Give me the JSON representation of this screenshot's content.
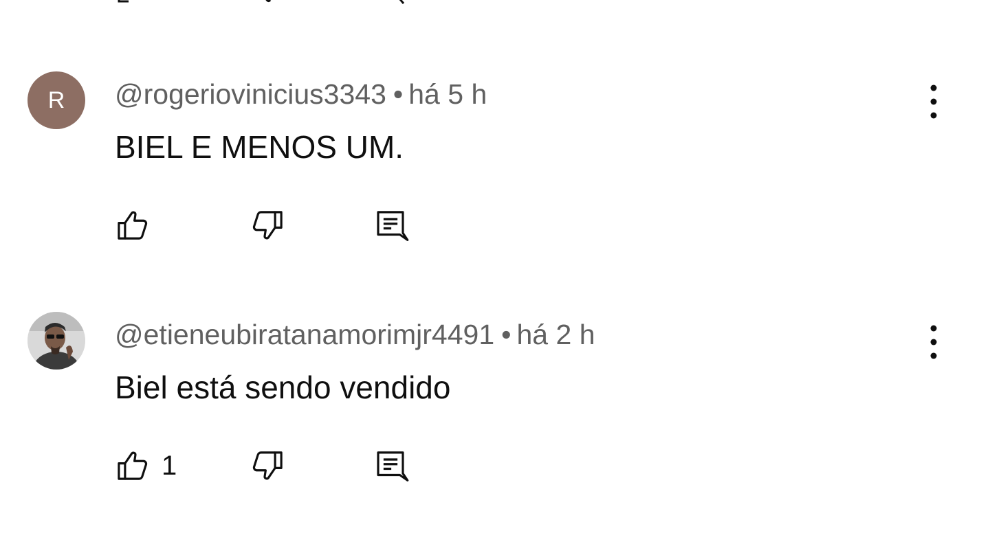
{
  "comments": [
    {
      "avatar": {
        "type": "letter",
        "letter": "R",
        "color": "#8d6e63"
      },
      "author": "@rogeriovinicius3343",
      "separator": "•",
      "time": "há 5 h",
      "text": "BIEL E MENOS UM.",
      "like_count": "",
      "icons": {
        "like": "thumb-up-icon",
        "dislike": "thumb-down-icon",
        "reply": "reply-icon",
        "menu": "more-vert-icon"
      }
    },
    {
      "avatar": {
        "type": "photo"
      },
      "author": "@etieneubiratanamorimjr4491",
      "separator": "•",
      "time": "há 2 h",
      "text": "Biel está sendo vendido",
      "like_count": "1",
      "icons": {
        "like": "thumb-up-icon",
        "dislike": "thumb-down-icon",
        "reply": "reply-icon",
        "menu": "more-vert-icon"
      }
    }
  ],
  "colors": {
    "text_primary": "#0f0f0f",
    "text_secondary": "#606060",
    "background": "#ffffff"
  }
}
